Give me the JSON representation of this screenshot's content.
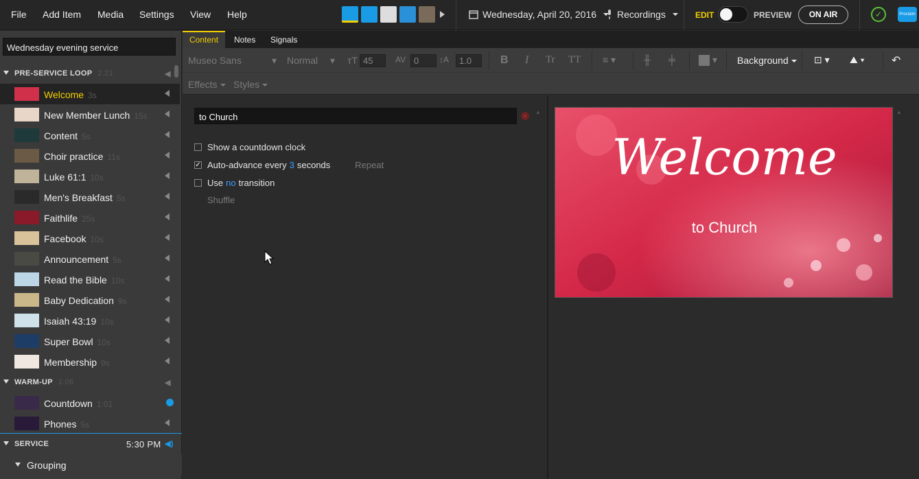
{
  "menu": [
    "File",
    "Add Item",
    "Media",
    "Settings",
    "View",
    "Help"
  ],
  "toolbar": {
    "date": "Wednesday, April 20, 2016",
    "recordings": "Recordings",
    "edit": "EDIT",
    "preview": "PREVIEW",
    "on_air": "ON AIR",
    "logo_text": "Proclaim"
  },
  "presentation_name": "Wednesday evening service",
  "sections": [
    {
      "name": "PRE-SERVICE LOOP",
      "duration": "2:21"
    },
    {
      "name": "WARM-UP",
      "duration": "1:06"
    },
    {
      "name": "SERVICE",
      "time": "5:30 PM"
    }
  ],
  "items": [
    {
      "name": "Welcome",
      "duration": "3s",
      "color": "#d0304a"
    },
    {
      "name": "New Member Lunch",
      "duration": "15s",
      "color": "#e8d7c9"
    },
    {
      "name": "Content",
      "duration": "5s",
      "color": "#1e3a3a"
    },
    {
      "name": "Choir practice",
      "duration": "11s",
      "color": "#6b5a45"
    },
    {
      "name": "Luke 61:1",
      "duration": "10s",
      "color": "#bfb49a"
    },
    {
      "name": "Men's Breakfast",
      "duration": "5s",
      "color": "#2a2a2a"
    },
    {
      "name": "Faithlife",
      "duration": "25s",
      "color": "#8a1a2a"
    },
    {
      "name": "Facebook",
      "duration": "10s",
      "color": "#d9c39a"
    },
    {
      "name": "Announcement",
      "duration": "5s",
      "color": "#4a4a44"
    },
    {
      "name": "Read the Bible",
      "duration": "10s",
      "color": "#bcd6e6"
    },
    {
      "name": "Baby Dedication",
      "duration": "9s",
      "color": "#c9b789"
    },
    {
      "name": "Isaiah 43:19",
      "duration": "10s",
      "color": "#cfe2ea"
    },
    {
      "name": "Super Bowl",
      "duration": "10s",
      "color": "#1e3d66"
    },
    {
      "name": "Membership",
      "duration": "9s",
      "color": "#efe8e0"
    }
  ],
  "warmup_items": [
    {
      "name": "Countdown",
      "duration": "1:01",
      "color": "#3a2a4a"
    },
    {
      "name": "Phones",
      "duration": "5s",
      "color": "#2a1a3a"
    }
  ],
  "grouping": "Grouping",
  "tabs": [
    "Content",
    "Notes",
    "Signals"
  ],
  "format": {
    "font": "Museo Sans",
    "weight": "Normal",
    "size": "45",
    "spacing": "0",
    "line": "1.0",
    "background": "Background",
    "effects": "Effects",
    "styles": "Styles"
  },
  "editor": {
    "text_value": "to Church",
    "countdown": "Show a countdown clock",
    "auto_advance_pre": "Auto-advance every",
    "auto_advance_num": "3",
    "auto_advance_post": "seconds",
    "repeat": "Repeat",
    "use": "Use",
    "no": "no",
    "transition": "transition",
    "shuffle": "Shuffle"
  },
  "slide": {
    "title": "Welcome",
    "subtitle": "to Church"
  }
}
